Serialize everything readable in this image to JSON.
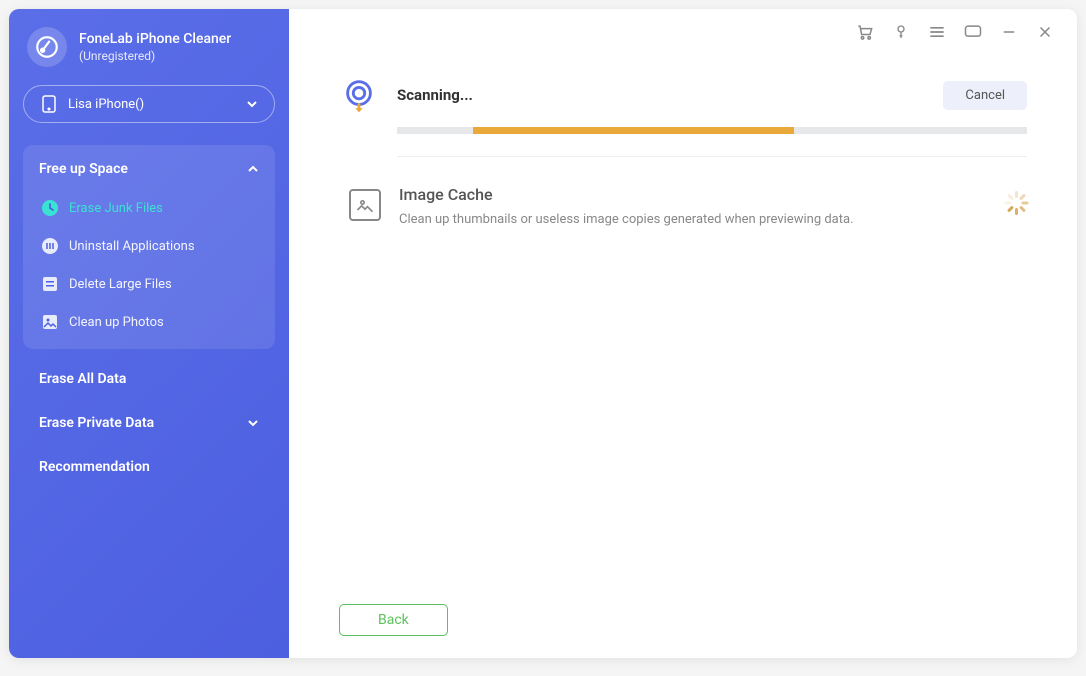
{
  "app": {
    "title": "FoneLab iPhone Cleaner",
    "subtitle": "(Unregistered)"
  },
  "device": {
    "name": "Lisa iPhone()"
  },
  "sidebar": {
    "free_up_space": "Free up Space",
    "items": [
      {
        "label": "Erase Junk Files"
      },
      {
        "label": "Uninstall Applications"
      },
      {
        "label": "Delete Large Files"
      },
      {
        "label": "Clean up Photos"
      }
    ],
    "erase_all": "Erase All Data",
    "erase_private": "Erase Private Data",
    "recommendation": "Recommendation"
  },
  "scan": {
    "status": "Scanning...",
    "cancel": "Cancel",
    "item_title": "Image Cache",
    "item_desc": "Clean up thumbnails or useless image copies generated when previewing data."
  },
  "footer": {
    "back": "Back"
  },
  "colors": {
    "sidebar": "#5366e6",
    "accent": "#39e3d3",
    "progress": "#e8a93a",
    "green": "#5cc15c"
  }
}
